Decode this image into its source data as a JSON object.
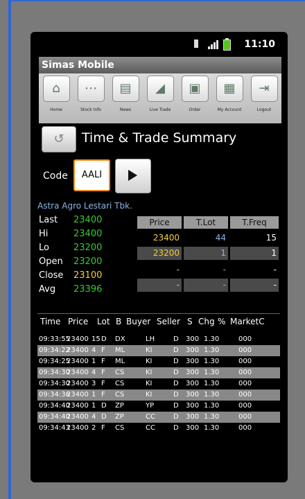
{
  "status": {
    "time": "11:10"
  },
  "app": {
    "title": "Simas Mobile"
  },
  "toolbar": [
    {
      "label": "Home",
      "icon": "home-icon",
      "glyph": "⌂"
    },
    {
      "label": "Stock Info",
      "icon": "stock-info-icon",
      "glyph": "⋯"
    },
    {
      "label": "News",
      "icon": "news-icon",
      "glyph": "▤"
    },
    {
      "label": "Live Trade",
      "icon": "live-trade-icon",
      "glyph": "◢"
    },
    {
      "label": "Order",
      "icon": "order-icon",
      "glyph": "▣"
    },
    {
      "label": "My Account",
      "icon": "account-icon",
      "glyph": "▦"
    },
    {
      "label": "Logout",
      "icon": "logout-icon",
      "glyph": "⇥"
    }
  ],
  "page": {
    "title": "Time & Trade Summary",
    "back_glyph": "↺"
  },
  "code": {
    "label": "Code",
    "value": "AALI"
  },
  "company": "Astra Agro Lestari Tbk.",
  "stats": [
    {
      "k": "Last",
      "v": "23400"
    },
    {
      "k": "Hi",
      "v": "23400"
    },
    {
      "k": "Lo",
      "v": "23200"
    },
    {
      "k": "Open",
      "v": "23200"
    },
    {
      "k": "Close",
      "v": "23100"
    },
    {
      "k": "Avg",
      "v": "23396"
    }
  ],
  "price_table": {
    "headers": [
      "Price",
      "T.Lot",
      "T.Freq"
    ],
    "rows": [
      [
        "23400",
        "44",
        "15"
      ],
      [
        "23200",
        "1",
        "1"
      ],
      [
        "-",
        "-",
        "-"
      ],
      [
        "-",
        "-",
        "-"
      ]
    ]
  },
  "trade_table": {
    "headers": [
      "Time",
      "Price",
      "Lot",
      "B",
      "Buyer",
      "Seller",
      "S",
      "Chg",
      "%",
      "MarketC"
    ],
    "rows": [
      [
        "09:33:55",
        "23400",
        "15",
        "D",
        "DX",
        "LH",
        "D",
        "300",
        "1.30",
        "000"
      ],
      [
        "09:34:22",
        "23400",
        "4",
        "F",
        "ML",
        "KI",
        "D",
        "300",
        "1.30",
        "000"
      ],
      [
        "09:34:25",
        "23400",
        "1",
        "F",
        "ML",
        "KI",
        "D",
        "300",
        "1.30",
        "000"
      ],
      [
        "09:34:30",
        "23400",
        "4",
        "F",
        "CS",
        "KI",
        "D",
        "300",
        "1.30",
        "000"
      ],
      [
        "09:34:30",
        "23400",
        "3",
        "F",
        "CS",
        "KI",
        "D",
        "300",
        "1.30",
        "000"
      ],
      [
        "09:34:36",
        "23400",
        "1",
        "F",
        "CS",
        "KI",
        "D",
        "300",
        "1.30",
        "000"
      ],
      [
        "09:34:40",
        "23400",
        "1",
        "D",
        "ZP",
        "YP",
        "D",
        "300",
        "1.30",
        "000"
      ],
      [
        "09:34:40",
        "23400",
        "4",
        "D",
        "ZP",
        "CC",
        "D",
        "300",
        "1.30",
        "000"
      ],
      [
        "09:34:43",
        "23400",
        "2",
        "F",
        "CS",
        "CC",
        "D",
        "300",
        "1.30",
        "000"
      ]
    ]
  }
}
